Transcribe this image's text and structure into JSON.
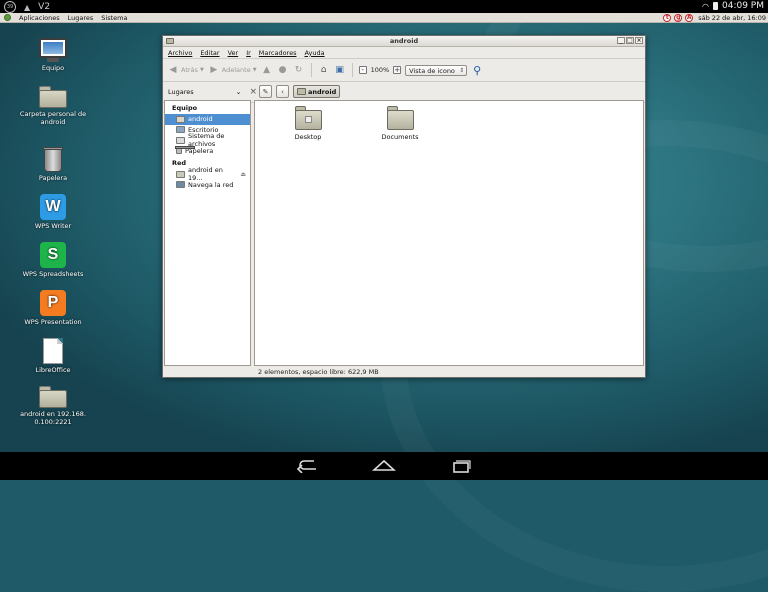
{
  "status_bar": {
    "badge": "39",
    "v2": "V2",
    "time": "04:09 PM"
  },
  "panel": {
    "menus": [
      "Aplicaciones",
      "Lugares",
      "Sistema"
    ],
    "tray_icons": [
      "t",
      "g",
      "A"
    ],
    "clock": "sáb 22 de abr, 16:09"
  },
  "desktop_icons": [
    {
      "label": "Equipo"
    },
    {
      "label": "Carpeta personal de android"
    },
    {
      "label": "Papelera"
    },
    {
      "label": "WPS Writer",
      "glyph": "W",
      "color": "#2e9be5"
    },
    {
      "label": "WPS Spreadsheets",
      "glyph": "S",
      "color": "#1db54a"
    },
    {
      "label": "WPS Presentation",
      "glyph": "P",
      "color": "#f47b20"
    },
    {
      "label": "LibreOffice"
    },
    {
      "label": "android en 192.168.0.100:2221"
    }
  ],
  "window": {
    "title": "android",
    "menu": [
      "Archivo",
      "Editar",
      "Ver",
      "Ir",
      "Marcadores",
      "Ayuda"
    ],
    "toolbar": {
      "back_label": "Atrás",
      "forward_label": "Adelante",
      "zoom_level": "100%",
      "view_mode": "Vista de icono"
    },
    "sidebar": {
      "selector_label": "Lugares",
      "sections": [
        {
          "title": "Equipo",
          "items": [
            {
              "label": "android",
              "icon": "home-folder-icon",
              "active": true
            },
            {
              "label": "Escritorio",
              "icon": "desktop-icon"
            },
            {
              "label": "Sistema de archivos",
              "icon": "drive-icon"
            },
            {
              "label": "Papelera",
              "icon": "trash-icon"
            }
          ]
        },
        {
          "title": "Red",
          "items": [
            {
              "label": "android en 19...",
              "icon": "network-folder-icon",
              "eject": true
            },
            {
              "label": "Navega la red",
              "icon": "network-icon"
            }
          ]
        }
      ]
    },
    "location": {
      "crumb": "android"
    },
    "files": [
      {
        "name": "Desktop"
      },
      {
        "name": "Documents"
      }
    ],
    "status": "2 elementos, espacio libre: 622,9 MB"
  }
}
